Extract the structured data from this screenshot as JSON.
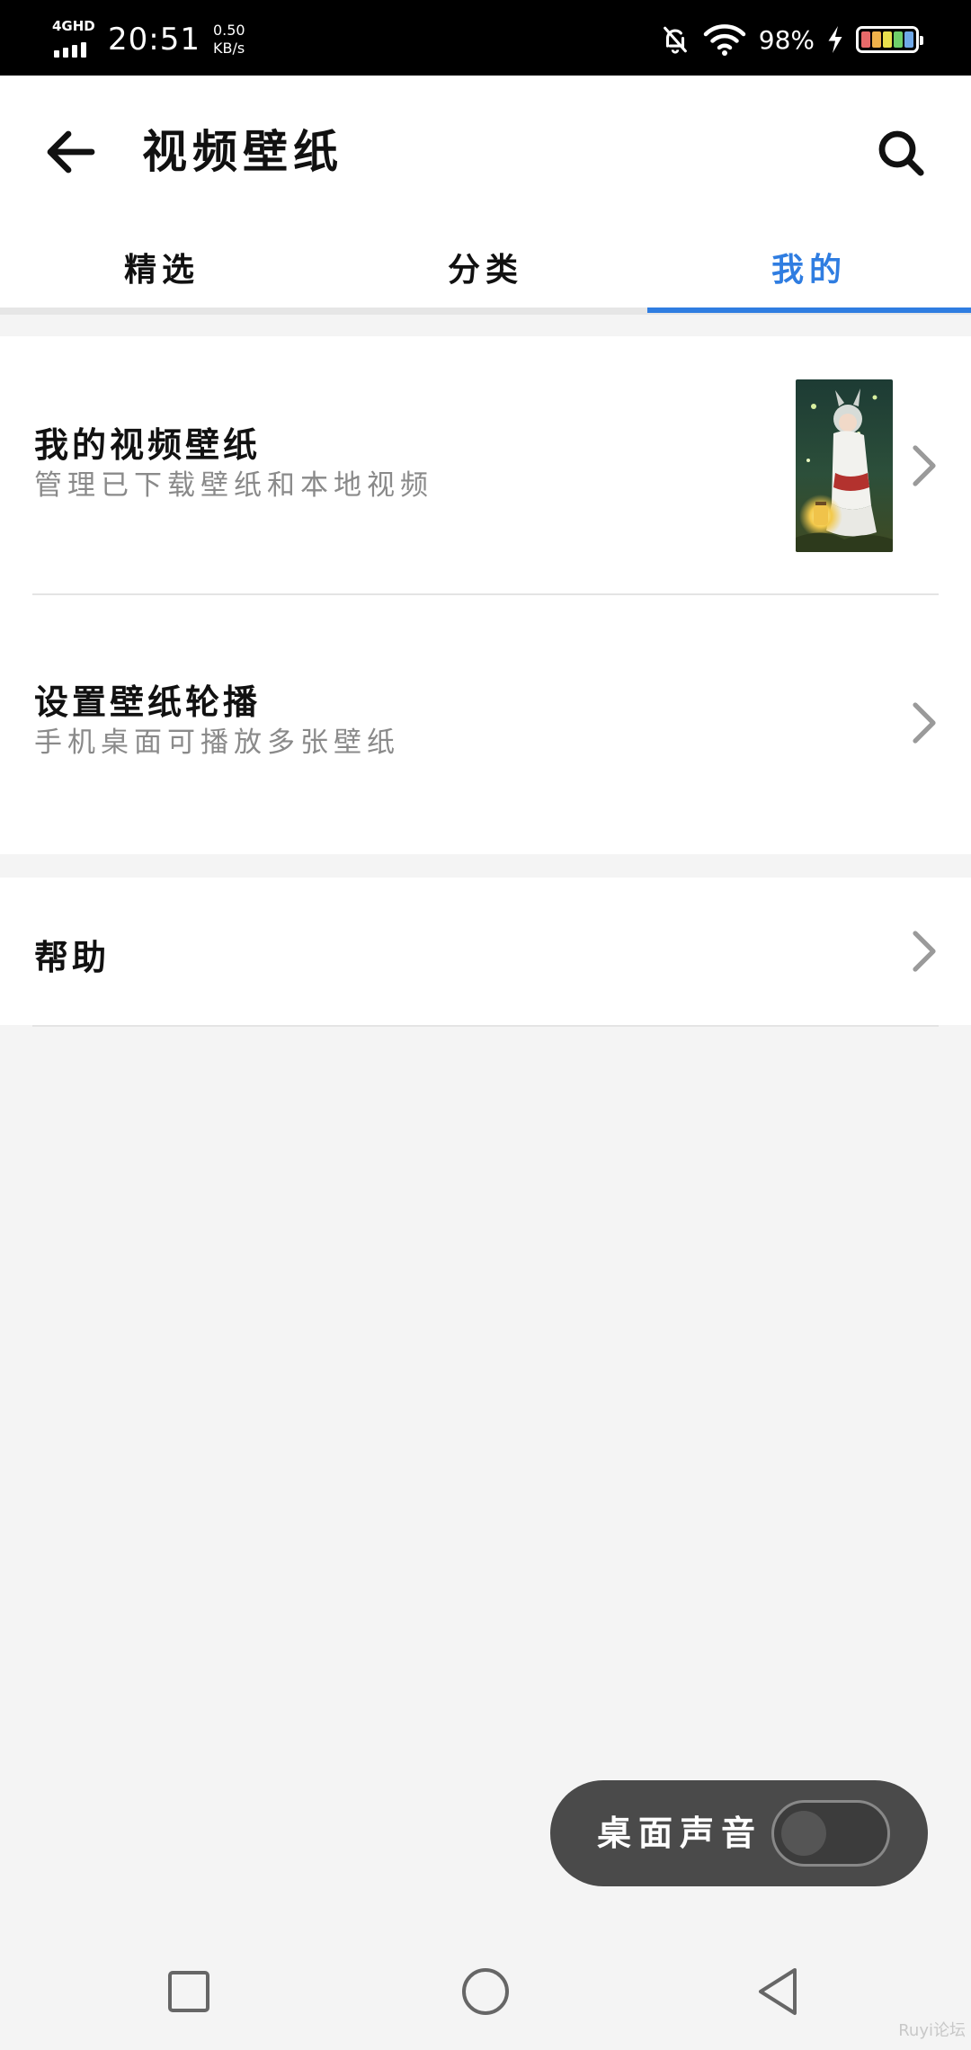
{
  "status_bar": {
    "network": "4GHD",
    "time": "20:51",
    "speed_value": "0.50",
    "speed_unit": "KB/s",
    "battery_percent": "98%",
    "icons": [
      "signal-icon",
      "mute-bell-icon",
      "wifi-icon",
      "charging-bolt-icon",
      "battery-icon"
    ]
  },
  "app_bar": {
    "title": "视频壁纸",
    "back_icon": "arrow-left-icon",
    "search_icon": "search-icon"
  },
  "tabs": [
    {
      "label": "精选",
      "active": false
    },
    {
      "label": "分类",
      "active": false
    },
    {
      "label": "我的",
      "active": true
    }
  ],
  "menu": {
    "my_wallpapers": {
      "title": "我的视频壁纸",
      "subtitle": "管理已下载壁纸和本地视频"
    },
    "carousel": {
      "title": "设置壁纸轮播",
      "subtitle": "手机桌面可播放多张壁纸"
    },
    "help": {
      "title": "帮助"
    }
  },
  "desktop_sound": {
    "label": "桌面声音",
    "enabled": false
  },
  "watermark": "Ruyi论坛",
  "colors": {
    "accent": "#2f7de1",
    "background": "#f4f4f4",
    "pill": "#4a4a4a"
  }
}
